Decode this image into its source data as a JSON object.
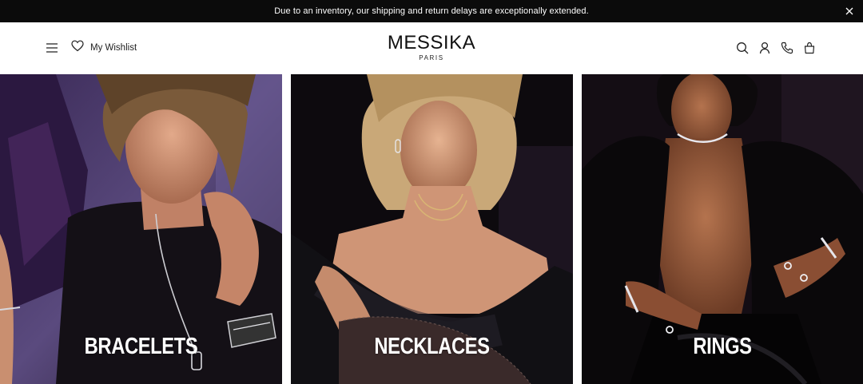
{
  "announcement": {
    "text": "Due to an inventory, our shipping and return delays are exceptionally extended.",
    "close_icon": "close-icon"
  },
  "header": {
    "menu_icon": "hamburger-menu-icon",
    "wishlist_label": "My Wishlist",
    "wishlist_icon": "heart-icon",
    "logo": {
      "wordmark": "MESSIKA",
      "subtitle": "PARIS"
    },
    "actions": [
      "search-icon",
      "account-icon",
      "phone-icon",
      "shopping-bag-icon"
    ]
  },
  "categories": [
    {
      "label": "BRACELETS"
    },
    {
      "label": "NECKLACES"
    },
    {
      "label": "RINGS"
    }
  ],
  "colors": {
    "announcement_bg": "#0b0b0b",
    "tile_bracelets_bg": "#3a2a55",
    "tile_necklaces_bg": "#0f0b10",
    "tile_rings_bg": "#120c12"
  }
}
